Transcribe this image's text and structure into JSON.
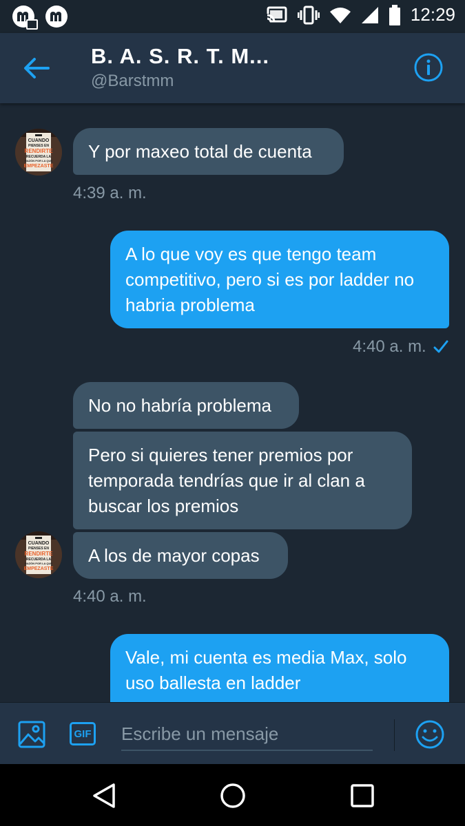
{
  "status_bar": {
    "time": "12:29",
    "icons": [
      "messenger-notification-icon",
      "messenger-notification-icon",
      "cast-icon",
      "vibrate-icon",
      "wifi-icon",
      "signal-icon",
      "battery-icon"
    ]
  },
  "header": {
    "title": "B. A. S. R. T. M...",
    "handle": "@Barstmm",
    "accent_color": "#1da1f2"
  },
  "messages": [
    {
      "direction": "received",
      "text": "Y por maxeo total de cuenta"
    },
    {
      "direction": "received_timestamp",
      "text": "4:39 a. m."
    },
    {
      "direction": "sent",
      "text": "A lo que voy es que tengo team competitivo, pero si es por ladder no habria problema"
    },
    {
      "direction": "sent_timestamp",
      "text": "4:40 a. m."
    },
    {
      "direction": "received",
      "text": "No no habría problema"
    },
    {
      "direction": "received",
      "text": "Pero si quieres tener premios por temporada tendrías que ir al clan a buscar los premios"
    },
    {
      "direction": "received",
      "text": "A los de mayor copas"
    },
    {
      "direction": "received_timestamp",
      "text": "4:40 a. m."
    },
    {
      "direction": "sent",
      "text": "Vale, mi cuenta es media Max, solo uso ballesta en ladder"
    }
  ],
  "avatar": {
    "lines": [
      "CUANDO",
      "PIENSES EN",
      "RENDIRTE",
      "RECUERDA LA",
      "RAZÓN POR LA QUE",
      "EMPEZASTE"
    ]
  },
  "composer": {
    "gif_label": "GIF",
    "placeholder": "Escribe un mensaje"
  },
  "colors": {
    "background": "#1c2733",
    "header": "#243447",
    "received_bubble": "#3d5466",
    "sent_bubble": "#1da1f2",
    "secondary_text": "#8899a6"
  }
}
